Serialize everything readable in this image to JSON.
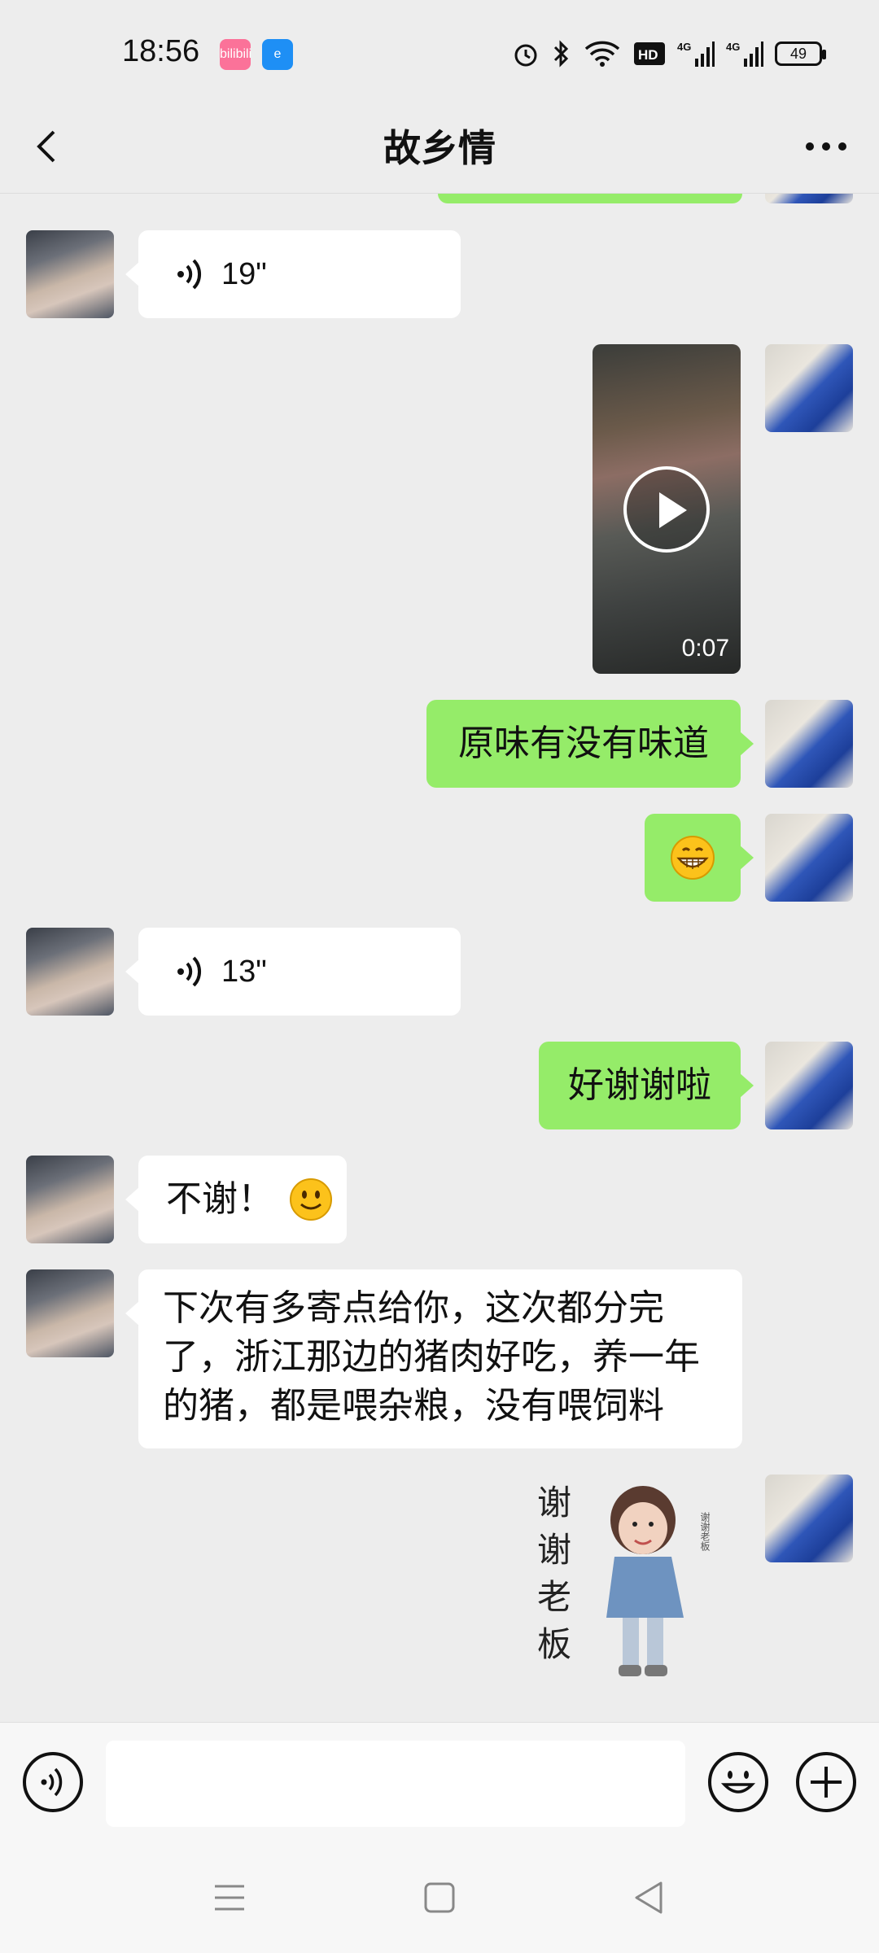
{
  "status_bar": {
    "time": "18:56",
    "battery": "49",
    "apps": [
      "bilibili",
      "饿了么"
    ],
    "icons": [
      "alarm-icon",
      "bluetooth-icon",
      "wifi-icon",
      "hd-icon",
      "signal-4g-icon",
      "signal-4g-icon",
      "battery-icon"
    ]
  },
  "header": {
    "title": "故乡情",
    "back_icon": "chevron-left-icon",
    "more_icon": "more-dots-icon"
  },
  "messages": [
    {
      "side": "left",
      "type": "voice",
      "duration": "19\""
    },
    {
      "side": "right",
      "type": "video",
      "duration": "0:07"
    },
    {
      "side": "right",
      "type": "text",
      "text": "原味有没有味道"
    },
    {
      "side": "right",
      "type": "emoji",
      "emoji": "grin-emoji"
    },
    {
      "side": "left",
      "type": "voice",
      "duration": "13\""
    },
    {
      "side": "right",
      "type": "text",
      "text": "好谢谢啦"
    },
    {
      "side": "left",
      "type": "text",
      "text": "不谢！"
    },
    {
      "side": "left",
      "type": "text",
      "lines": [
        "下次有多寄点给你，这次都分完",
        "了，浙江那边的猪肉好吃，养一年",
        "的猪，都是喂杂粮，没有喂饲料"
      ]
    },
    {
      "side": "right",
      "type": "sticker",
      "sticker_text": [
        "谢",
        "谢",
        "老",
        "板"
      ],
      "side_text": "谢谢老板"
    }
  ],
  "input_bar": {
    "voice_icon": "voice-mode-icon",
    "emoji_icon": "emoji-icon",
    "plus_icon": "plus-icon",
    "input_value": ""
  },
  "system_nav": [
    "menu-icon",
    "home-icon",
    "back-icon"
  ],
  "colors": {
    "background": "#ededed",
    "bubble_self": "#95ec69",
    "bubble_other": "#ffffff"
  }
}
